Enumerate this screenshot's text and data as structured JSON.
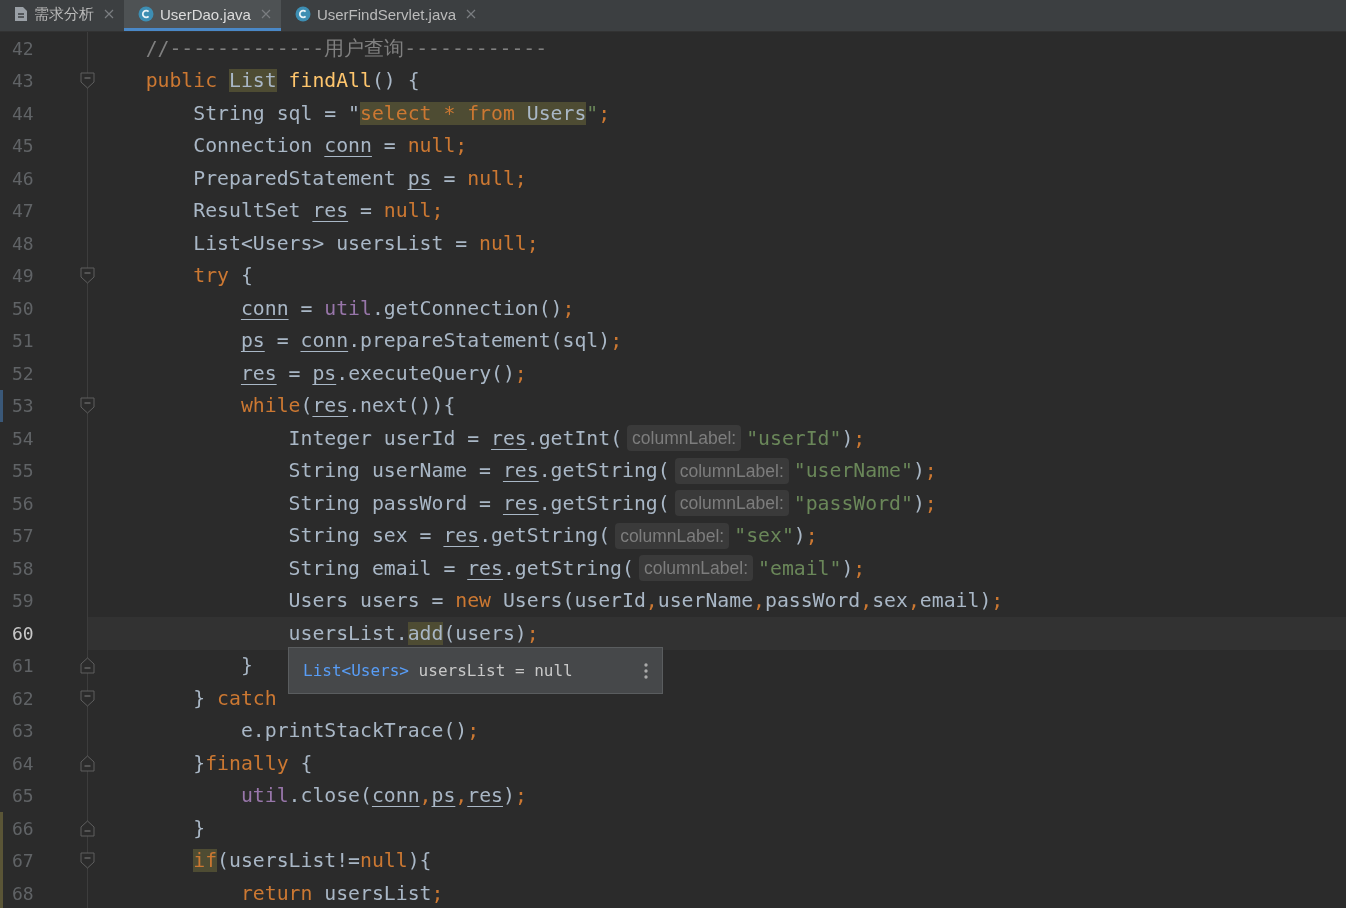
{
  "tabs": [
    {
      "label": "需求分析",
      "kind": "document",
      "selected": false
    },
    {
      "label": "UserDao.java",
      "kind": "class",
      "selected": true
    },
    {
      "label": "UserFindServlet.java",
      "kind": "class",
      "selected": false
    }
  ],
  "lines": [
    {
      "number": "42",
      "current": false,
      "tokens": [
        {
          "t": "    //-------------用户查询------------",
          "kind": "comment"
        }
      ]
    },
    {
      "number": "43",
      "current": false,
      "fold": {
        "kind": "open"
      },
      "tokens": [
        {
          "t": "    public ",
          "kind": "kw"
        },
        {
          "t": "List",
          "kind": "plain",
          "mark": true
        },
        {
          "t": " findAll",
          "kind": "fn"
        },
        {
          "t": "() {",
          "kind": "plain"
        }
      ]
    },
    {
      "number": "44",
      "current": false,
      "tokens": [
        {
          "t": "        String sql = \"",
          "kind": "plain"
        },
        {
          "t": "select * from",
          "kind": "kw",
          "mark": true
        },
        {
          "t": " Users",
          "kind": "plain",
          "mark": true
        },
        {
          "t": "\"",
          "kind": "str"
        },
        {
          "t": ";",
          "kind": "kw"
        }
      ]
    },
    {
      "number": "45",
      "current": false,
      "tokens": [
        {
          "t": "        Connection ",
          "kind": "plain"
        },
        {
          "t": "conn",
          "kind": "var"
        },
        {
          "t": " = ",
          "kind": "plain"
        },
        {
          "t": "null;",
          "kind": "kw"
        }
      ]
    },
    {
      "number": "46",
      "current": false,
      "tokens": [
        {
          "t": "        PreparedStatement ",
          "kind": "plain"
        },
        {
          "t": "ps",
          "kind": "var"
        },
        {
          "t": " = ",
          "kind": "plain"
        },
        {
          "t": "null;",
          "kind": "kw"
        }
      ]
    },
    {
      "number": "47",
      "current": false,
      "tokens": [
        {
          "t": "        ResultSet ",
          "kind": "plain"
        },
        {
          "t": "res",
          "kind": "var"
        },
        {
          "t": " = ",
          "kind": "plain"
        },
        {
          "t": "null;",
          "kind": "kw"
        }
      ]
    },
    {
      "number": "48",
      "current": false,
      "tokens": [
        {
          "t": "        List<Users> usersList = ",
          "kind": "plain"
        },
        {
          "t": "null;",
          "kind": "kw"
        }
      ]
    },
    {
      "number": "49",
      "current": false,
      "fold": {
        "kind": "open"
      },
      "tokens": [
        {
          "t": "        try",
          "kind": "kw"
        },
        {
          "t": " {",
          "kind": "plain"
        }
      ]
    },
    {
      "number": "50",
      "current": false,
      "tokens": [
        {
          "t": "            conn",
          "kind": "var"
        },
        {
          "t": " = ",
          "kind": "plain"
        },
        {
          "t": "util",
          "kind": "field"
        },
        {
          "t": ".getConnection()",
          "kind": "plain"
        },
        {
          "t": ";",
          "kind": "kw"
        }
      ]
    },
    {
      "number": "51",
      "current": false,
      "tokens": [
        {
          "t": "            ps",
          "kind": "var"
        },
        {
          "t": " = ",
          "kind": "plain"
        },
        {
          "t": "conn",
          "kind": "var"
        },
        {
          "t": ".prepareStatement(sql)",
          "kind": "plain"
        },
        {
          "t": ";",
          "kind": "kw"
        }
      ]
    },
    {
      "number": "52",
      "current": false,
      "tokens": [
        {
          "t": "            res",
          "kind": "var"
        },
        {
          "t": " = ",
          "kind": "plain"
        },
        {
          "t": "ps",
          "kind": "var"
        },
        {
          "t": ".executeQuery()",
          "kind": "plain"
        },
        {
          "t": ";",
          "kind": "kw"
        }
      ]
    },
    {
      "number": "53",
      "current": false,
      "fold": {
        "kind": "open"
      },
      "change": {
        "kind": "modified"
      },
      "tokens": [
        {
          "t": "            while",
          "kind": "kw"
        },
        {
          "t": "(",
          "kind": "plain"
        },
        {
          "t": "res",
          "kind": "var"
        },
        {
          "t": ".next()){",
          "kind": "plain"
        }
      ]
    },
    {
      "number": "54",
      "current": false,
      "tokens": [
        {
          "t": "                Integer userId = ",
          "kind": "plain"
        },
        {
          "t": "res",
          "kind": "var"
        },
        {
          "t": ".getInt(",
          "kind": "plain"
        },
        {
          "t": "columnLabel:",
          "kind": "hint"
        },
        {
          "t": "\"userId\"",
          "kind": "str"
        },
        {
          "t": ")",
          "kind": "plain"
        },
        {
          "t": ";",
          "kind": "kw"
        }
      ]
    },
    {
      "number": "55",
      "current": false,
      "tokens": [
        {
          "t": "                String userName = ",
          "kind": "plain"
        },
        {
          "t": "res",
          "kind": "var"
        },
        {
          "t": ".getString(",
          "kind": "plain"
        },
        {
          "t": "columnLabel:",
          "kind": "hint"
        },
        {
          "t": "\"userName\"",
          "kind": "str"
        },
        {
          "t": ")",
          "kind": "plain"
        },
        {
          "t": ";",
          "kind": "kw"
        }
      ]
    },
    {
      "number": "56",
      "current": false,
      "tokens": [
        {
          "t": "                String passWord = ",
          "kind": "plain"
        },
        {
          "t": "res",
          "kind": "var"
        },
        {
          "t": ".getString(",
          "kind": "plain"
        },
        {
          "t": "columnLabel:",
          "kind": "hint"
        },
        {
          "t": "\"passWord\"",
          "kind": "str"
        },
        {
          "t": ")",
          "kind": "plain"
        },
        {
          "t": ";",
          "kind": "kw"
        }
      ]
    },
    {
      "number": "57",
      "current": false,
      "tokens": [
        {
          "t": "                String sex = ",
          "kind": "plain"
        },
        {
          "t": "res",
          "kind": "var"
        },
        {
          "t": ".getString(",
          "kind": "plain"
        },
        {
          "t": "columnLabel:",
          "kind": "hint"
        },
        {
          "t": "\"sex\"",
          "kind": "str"
        },
        {
          "t": ")",
          "kind": "plain"
        },
        {
          "t": ";",
          "kind": "kw"
        }
      ]
    },
    {
      "number": "58",
      "current": false,
      "tokens": [
        {
          "t": "                String email = ",
          "kind": "plain"
        },
        {
          "t": "res",
          "kind": "var"
        },
        {
          "t": ".getString(",
          "kind": "plain"
        },
        {
          "t": "columnLabel:",
          "kind": "hint"
        },
        {
          "t": "\"email\"",
          "kind": "str"
        },
        {
          "t": ")",
          "kind": "plain"
        },
        {
          "t": ";",
          "kind": "kw"
        }
      ]
    },
    {
      "number": "59",
      "current": false,
      "tokens": [
        {
          "t": "                Users users = ",
          "kind": "plain"
        },
        {
          "t": "new",
          "kind": "kw"
        },
        {
          "t": " Users(userId",
          "kind": "plain"
        },
        {
          "t": ",",
          "kind": "kw"
        },
        {
          "t": "userName",
          "kind": "plain"
        },
        {
          "t": ",",
          "kind": "kw"
        },
        {
          "t": "passWord",
          "kind": "plain"
        },
        {
          "t": ",",
          "kind": "kw"
        },
        {
          "t": "sex",
          "kind": "plain"
        },
        {
          "t": ",",
          "kind": "kw"
        },
        {
          "t": "email)",
          "kind": "plain"
        },
        {
          "t": ";",
          "kind": "kw"
        }
      ]
    },
    {
      "number": "60",
      "current": true,
      "tokens": [
        {
          "t": "                usersList.",
          "kind": "plain"
        },
        {
          "t": "add",
          "kind": "plain",
          "mark": true
        },
        {
          "t": "(users)",
          "kind": "plain"
        },
        {
          "t": ";",
          "kind": "kw"
        }
      ]
    },
    {
      "number": "61",
      "current": false,
      "fold": {
        "kind": "close"
      },
      "tokens": [
        {
          "t": "            }",
          "kind": "plain"
        }
      ]
    },
    {
      "number": "62",
      "current": false,
      "fold": {
        "kind": "open"
      },
      "tokens": [
        {
          "t": "        } ",
          "kind": "plain"
        },
        {
          "t": "catch",
          "kind": "kw"
        }
      ]
    },
    {
      "number": "63",
      "current": false,
      "tokens": [
        {
          "t": "            e.printStackTrace()",
          "kind": "plain"
        },
        {
          "t": ";",
          "kind": "kw"
        }
      ]
    },
    {
      "number": "64",
      "current": false,
      "fold": {
        "kind": "close"
      },
      "tokens": [
        {
          "t": "        }",
          "kind": "plain"
        },
        {
          "t": "finally",
          "kind": "kw"
        },
        {
          "t": " {",
          "kind": "plain"
        }
      ]
    },
    {
      "number": "65",
      "current": false,
      "tokens": [
        {
          "t": "            util",
          "kind": "field"
        },
        {
          "t": ".close(",
          "kind": "plain"
        },
        {
          "t": "conn",
          "kind": "var"
        },
        {
          "t": ",",
          "kind": "kw"
        },
        {
          "t": "ps",
          "kind": "var"
        },
        {
          "t": ",",
          "kind": "kw"
        },
        {
          "t": "res",
          "kind": "var"
        },
        {
          "t": ")",
          "kind": "plain"
        },
        {
          "t": ";",
          "kind": "kw"
        }
      ]
    },
    {
      "number": "66",
      "current": false,
      "fold": {
        "kind": "close"
      },
      "change": {
        "kind": "unversioned"
      },
      "tokens": [
        {
          "t": "        }",
          "kind": "plain"
        }
      ]
    },
    {
      "number": "67",
      "current": false,
      "fold": {
        "kind": "open"
      },
      "change": {
        "kind": "unversioned"
      },
      "tokens": [
        {
          "t": "        if",
          "kind": "kw",
          "mark": true
        },
        {
          "t": "(usersList!=",
          "kind": "plain"
        },
        {
          "t": "null",
          "kind": "kw"
        },
        {
          "t": "){",
          "kind": "plain"
        }
      ]
    },
    {
      "number": "68",
      "current": false,
      "change": {
        "kind": "unversioned"
      },
      "tokens": [
        {
          "t": "            return",
          "kind": "kw"
        },
        {
          "t": " usersList",
          "kind": "plain"
        },
        {
          "t": ";",
          "kind": "kw"
        }
      ]
    }
  ],
  "tooltip": {
    "type": "List<Users>",
    "text": "usersList = null"
  }
}
